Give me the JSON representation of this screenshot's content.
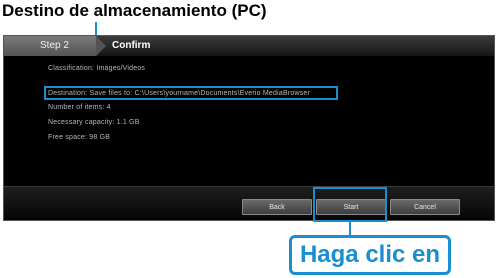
{
  "callout": {
    "top_title": "Destino de almacenamiento (PC)",
    "click_label": "Haga clic en"
  },
  "window": {
    "step_label": "Step 2",
    "title": "Confirm"
  },
  "info": {
    "line1": "Classification: Images/Videos",
    "line2": "Destination: Save files to: C:\\Users\\yourname\\Documents\\Everio MediaBrowser",
    "line3": "Number of items: 4",
    "line4": "Necessary capacity: 1.1 GB",
    "line5": "Free space: 98 GB"
  },
  "buttons": {
    "back": "Back",
    "start": "Start",
    "cancel": "Cancel"
  },
  "colors": {
    "accent": "#1a8fd0",
    "window_bg": "#000000"
  }
}
